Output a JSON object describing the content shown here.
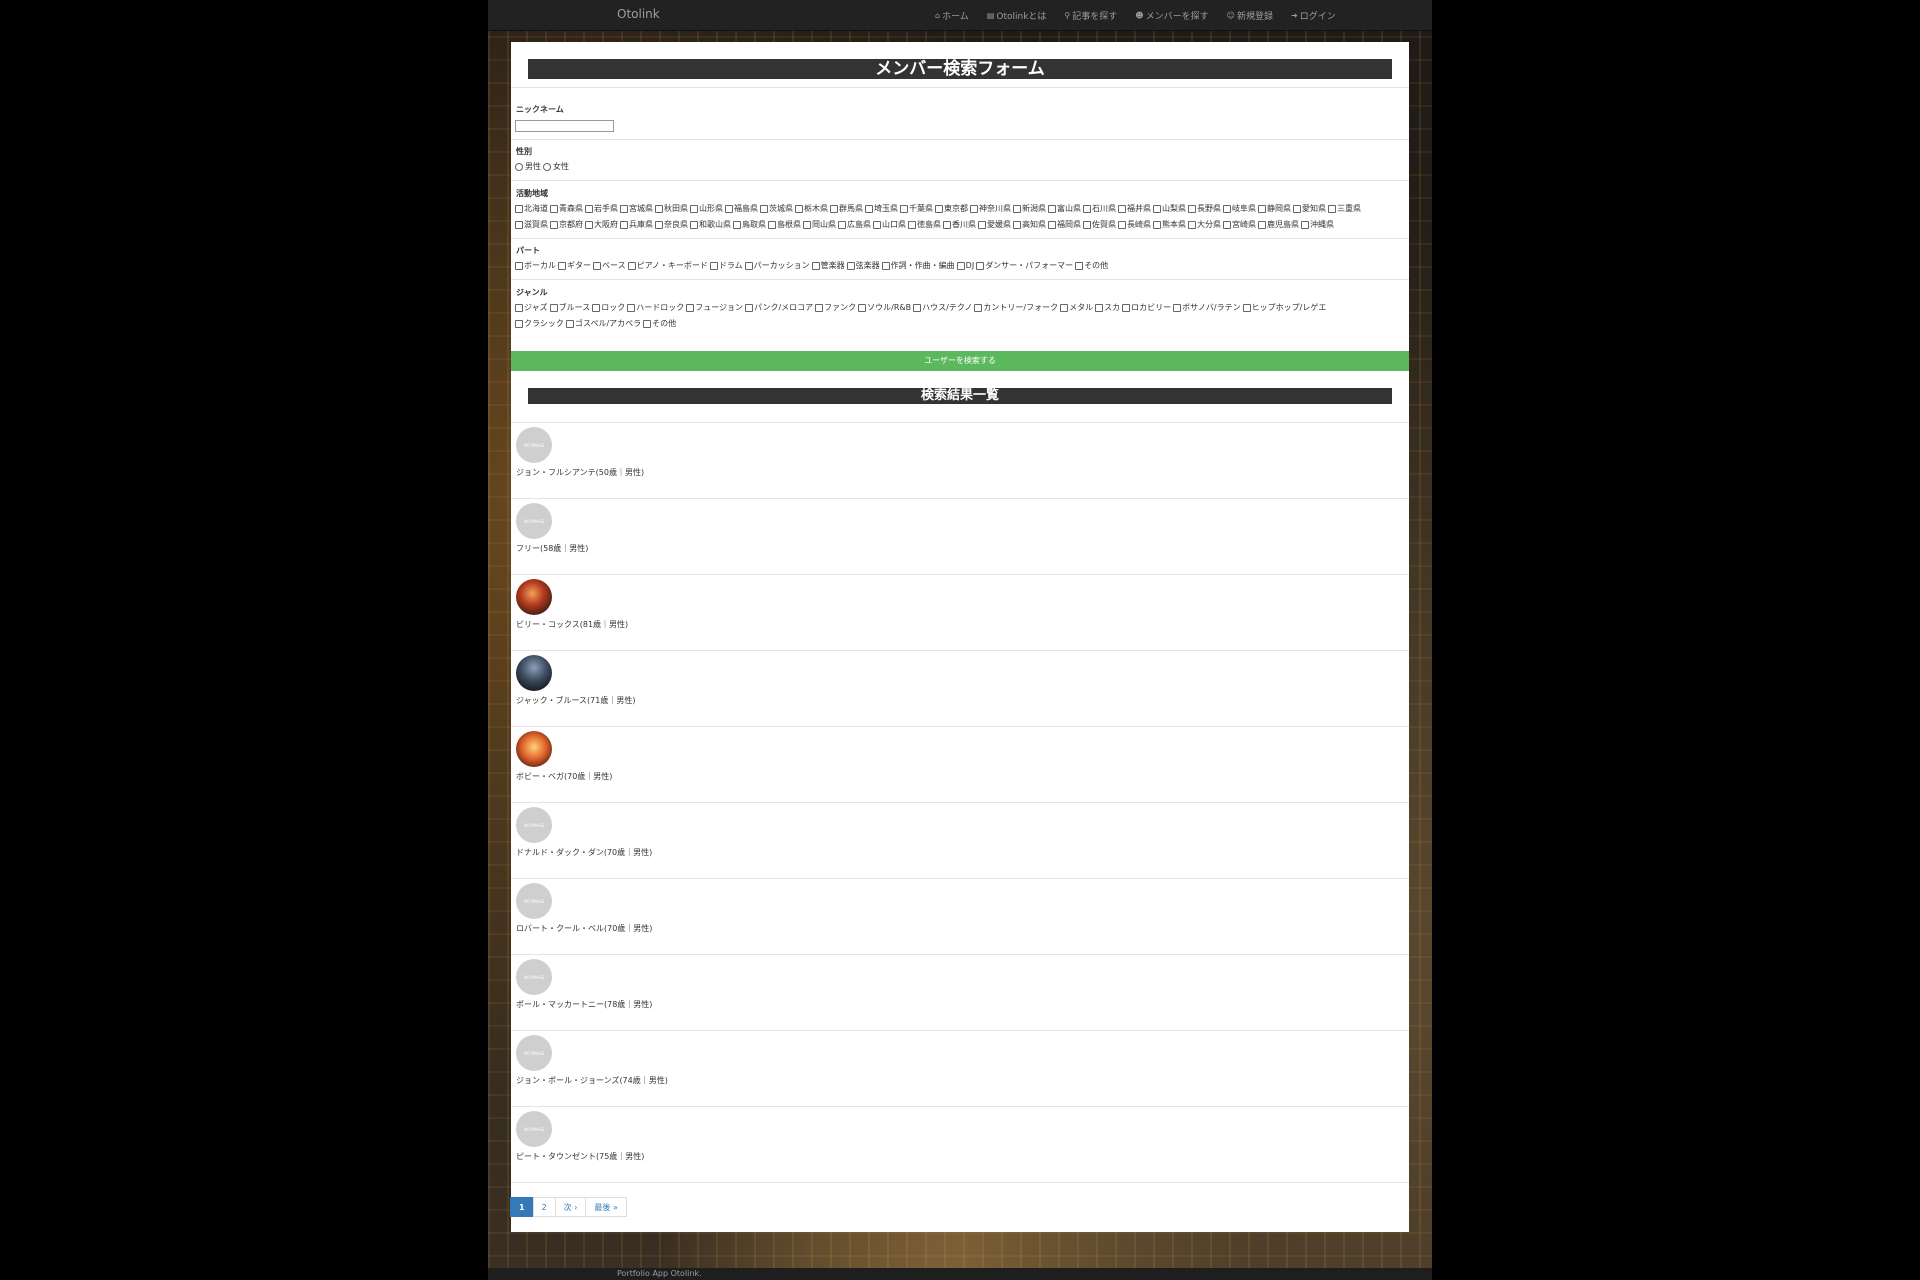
{
  "navbar": {
    "brand": "Otolink",
    "links": [
      {
        "icon": "home-icon",
        "glyph": "⌂",
        "label": "ホーム"
      },
      {
        "icon": "file-icon",
        "glyph": "▤",
        "label": "Otolinkとは"
      },
      {
        "icon": "search-icon",
        "glyph": "⚲",
        "label": "記事を探す"
      },
      {
        "icon": "users-icon",
        "glyph": "☻",
        "label": "メンバーを探す"
      },
      {
        "icon": "user-add-icon",
        "glyph": "☺",
        "label": "新規登録"
      },
      {
        "icon": "login-icon",
        "glyph": "➜",
        "label": "ログイン"
      }
    ]
  },
  "form": {
    "title": "メンバー検索フォーム",
    "nickname_label": "ニックネーム",
    "nickname_value": "",
    "gender_label": "性別",
    "genders": [
      "男性",
      "女性"
    ],
    "region_label": "活動地域",
    "regions_row1": [
      "北海道",
      "青森県",
      "岩手県",
      "宮城県",
      "秋田県",
      "山形県",
      "福島県",
      "茨城県",
      "栃木県",
      "群馬県",
      "埼玉県",
      "千葉県",
      "東京都",
      "神奈川県",
      "新潟県",
      "富山県",
      "石川県",
      "福井県",
      "山梨県",
      "長野県",
      "岐阜県",
      "静岡県",
      "愛知県",
      "三重県"
    ],
    "regions_row2": [
      "滋賀県",
      "京都府",
      "大阪府",
      "兵庫県",
      "奈良県",
      "和歌山県",
      "鳥取県",
      "島根県",
      "岡山県",
      "広島県",
      "山口県",
      "徳島県",
      "香川県",
      "愛媛県",
      "高知県",
      "福岡県",
      "佐賀県",
      "長崎県",
      "熊本県",
      "大分県",
      "宮崎県",
      "鹿児島県",
      "沖縄県"
    ],
    "part_label": "パート",
    "parts": [
      "ボーカル",
      "ギター",
      "ベース",
      "ピアノ・キーボード",
      "ドラム",
      "パーカッション",
      "管楽器",
      "弦楽器",
      "作詞・作曲・編曲",
      "DJ",
      "ダンサー・パフォーマー",
      "その他"
    ],
    "genre_label": "ジャンル",
    "genres_row1": [
      "ジャズ",
      "ブルース",
      "ロック",
      "ハードロック",
      "フュージョン",
      "パンク/メロコア",
      "ファンク",
      "ソウル/R&B",
      "ハウス/テクノ",
      "カントリー/フォーク",
      "メタル",
      "スカ",
      "ロカビリー",
      "ボサノバ/ラテン",
      "ヒップホップ/レゲエ"
    ],
    "genres_row2": [
      "クラシック",
      "ゴスペル/アカペラ",
      "その他"
    ],
    "submit_label": "ユーザーを検索する"
  },
  "results": {
    "title": "検索結果一覧",
    "no_image_text": "NO IMAGE",
    "users": [
      {
        "name": "ジョン・フルシアンテ(50歳｜男性)",
        "avatar": "none"
      },
      {
        "name": "フリー(58歳｜男性)",
        "avatar": "none"
      },
      {
        "name": "ビリー・コックス(81歳｜男性)",
        "avatar": "photo1"
      },
      {
        "name": "ジャック・ブルース(71歳｜男性)",
        "avatar": "photo2"
      },
      {
        "name": "ボビー・ベガ(70歳｜男性)",
        "avatar": "photo3"
      },
      {
        "name": "ドナルド・ダック・ダン(70歳｜男性)",
        "avatar": "none"
      },
      {
        "name": "ロバート・クール・ベル(70歳｜男性)",
        "avatar": "none"
      },
      {
        "name": "ポール・マッカートニー(78歳｜男性)",
        "avatar": "none"
      },
      {
        "name": "ジョン・ポール・ジョーンズ(74歳｜男性)",
        "avatar": "none"
      },
      {
        "name": "ピート・タウンゼント(75歳｜男性)",
        "avatar": "none"
      }
    ]
  },
  "pagination": [
    {
      "label": "1",
      "active": true
    },
    {
      "label": "2",
      "active": false
    },
    {
      "label": "次 ›",
      "active": false
    },
    {
      "label": "最後 »",
      "active": false
    }
  ],
  "footer": "Portfolio App Otolink.",
  "colors": {
    "navbar": "#222222",
    "button": "#5cb85c",
    "heading": "#333333",
    "page_active": "#337ab7"
  }
}
